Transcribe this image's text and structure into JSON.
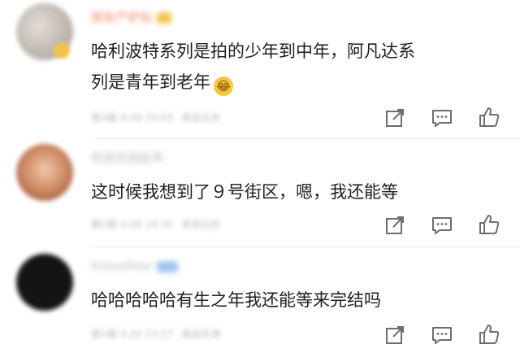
{
  "comments": [
    {
      "username": "朋友产驴仙",
      "avatar_color": "#c9c4be",
      "badge": "crown",
      "text_line1": "哈利波特系列是拍的少年到中年，阿凡达系",
      "text_line2": "列是青年到老年",
      "emoji": "laugh-cry",
      "time": "第3楼 4-20 15:03",
      "source": "来自北京"
    },
    {
      "username": "你自在如此年",
      "avatar_color": "#c98a6a",
      "text_line1": "这时候我想到了９号街区，嗯，我还能等",
      "time": "第2楼 4-20 14:35",
      "source": "来自北京"
    },
    {
      "username": "lnlovefree",
      "avatar_color": "#1a1a1a",
      "badge": "vip",
      "text_line1": "哈哈哈哈哈有生之年我还能等来完结吗",
      "time": "第1楼 4-20 13:27",
      "source": "来自天津"
    }
  ],
  "icons": {
    "share": "share-icon",
    "reply": "comment-icon",
    "like": "thumbs-up-icon"
  },
  "colors": {
    "username": "#e8885a",
    "username_muted": "#b8b8b8",
    "text": "#1e1e1e",
    "meta": "#b5b5b5",
    "icon": "#6e6e6e"
  }
}
